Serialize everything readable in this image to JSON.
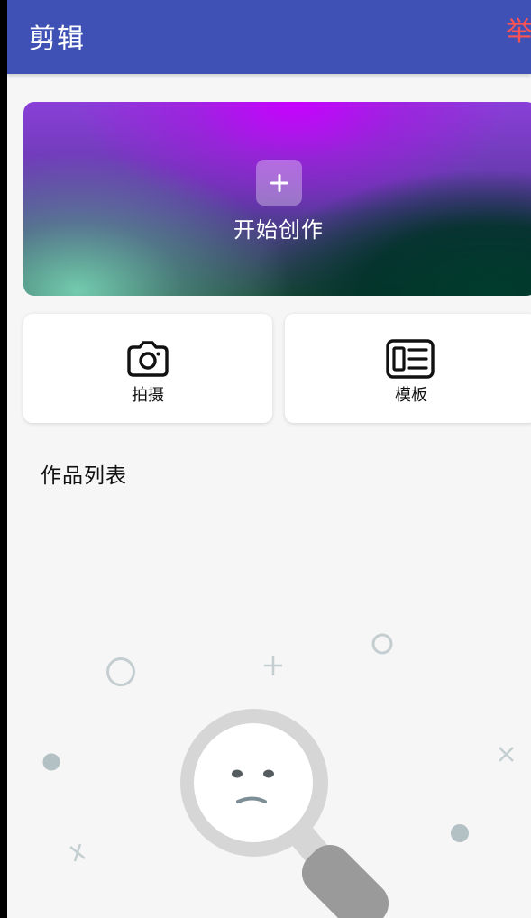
{
  "app_bar": {
    "title": "剪辑",
    "report_label": "举报"
  },
  "create": {
    "label": "开始创作",
    "icon": "plus-icon"
  },
  "tools": [
    {
      "label": "拍摄",
      "icon": "camera-icon"
    },
    {
      "label": "模板",
      "icon": "template-icon"
    }
  ],
  "works": {
    "title": "作品列表",
    "empty_icon": "magnifier-sad-face-icon"
  },
  "colors": {
    "app_bar": "#3f51b5",
    "report": "#ff5252",
    "background": "#f6f6f6"
  }
}
